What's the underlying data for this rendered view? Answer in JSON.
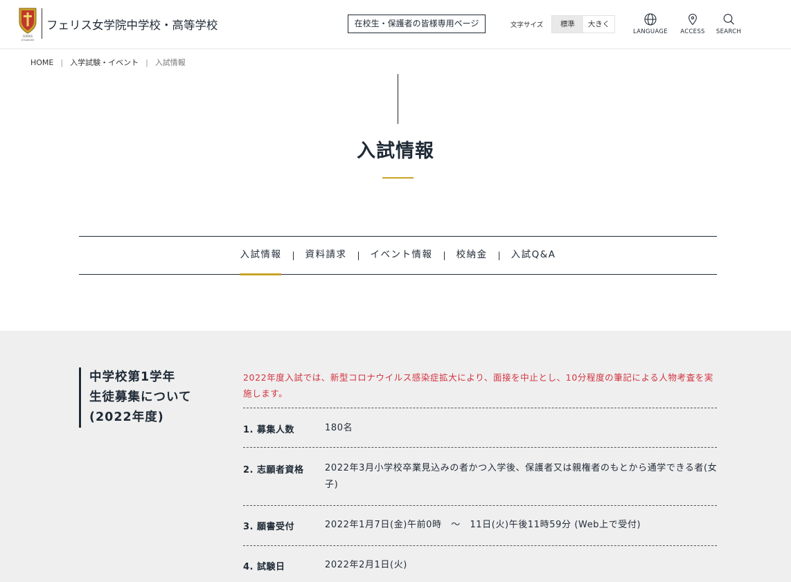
{
  "header": {
    "site_name": "フェリス女学院中学校・高等学校",
    "logo_text": "FERRIS JOGAKUIN",
    "members_button": "在校生・保護者の皆様専用ページ",
    "font_size_label": "文字サイズ",
    "font_size_options": [
      "標準",
      "大きく"
    ],
    "utilities": [
      {
        "label": "LANGUAGE",
        "icon": "globe-icon"
      },
      {
        "label": "ACCESS",
        "icon": "location-pin-icon"
      },
      {
        "label": "SEARCH",
        "icon": "search-icon"
      }
    ]
  },
  "breadcrumb": {
    "items": [
      "HOME",
      "入学試験・イベント",
      "入試情報"
    ],
    "separator": "|"
  },
  "page": {
    "title": "入試情報"
  },
  "subnav": {
    "items": [
      "入試情報",
      "資料請求",
      "イベント情報",
      "校納金",
      "入試Q&A"
    ],
    "active_index": 0,
    "separator": "|"
  },
  "section": {
    "title_lines": [
      "中学校第1学年",
      "生徒募集について",
      "(2022年度)"
    ],
    "notice": "2022年度入試では、新型コロナウイルス感染症拡大により、面接を中止とし、10分程度の筆記による人物考査を実施します。",
    "rows": [
      {
        "key": "1. 募集人数",
        "value": "180名"
      },
      {
        "key": "2. 志願者資格",
        "value": "2022年3月小学校卒業見込みの者かつ入学後、保護者又は親権者のもとから通学できる者(女子)"
      },
      {
        "key": "3. 願書受付",
        "value": "2022年1月7日(金)午前0時　～　11日(火)午後11時59分 (Web上で受付)"
      },
      {
        "key": "4. 試験日",
        "value": "2022年2月1日(火)"
      }
    ]
  },
  "colors": {
    "navy": "#1f2a36",
    "gold": "#c8a429",
    "notice_red": "#d2333f",
    "section_bg": "#efefef"
  }
}
